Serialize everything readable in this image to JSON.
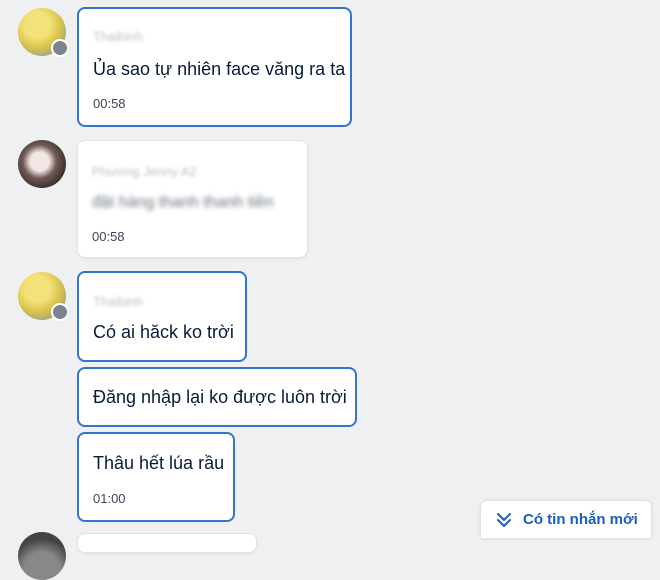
{
  "messages": [
    {
      "sender": "Thaibinh",
      "text": "Ủa sao tự nhiên face văng ra ta",
      "time": "00:58"
    },
    {
      "sender": "Phương Jenny A2",
      "text": "đặt hàng thanh thanh tiền",
      "time": "00:58"
    },
    {
      "sender": "Thaibinh",
      "text": "Có ai hăck ko trời"
    },
    {
      "text": "Đăng nhập lại ko được luôn trời"
    },
    {
      "text": "Thâu hết lúa rầu",
      "time": "01:00"
    }
  ],
  "new_messages_button": {
    "label": "Có tin nhắn mới",
    "icon": "chevrons-down-icon",
    "color": "#1a5dc0"
  },
  "colors": {
    "accent_border": "#3474cf",
    "background": "#eef0f1"
  }
}
